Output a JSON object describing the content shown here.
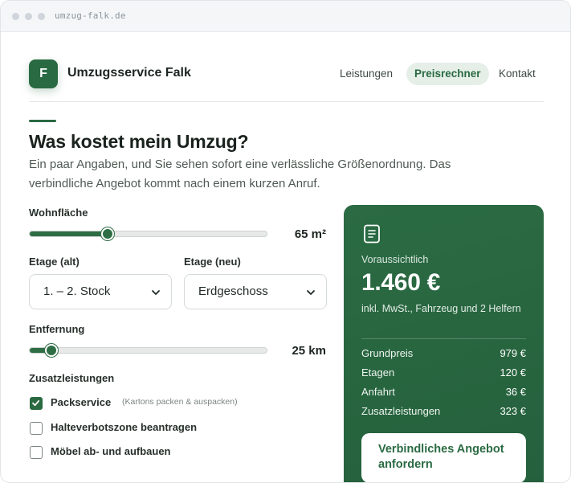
{
  "browser": {
    "url": "umzug-falk.de"
  },
  "header": {
    "logo_letter": "F",
    "brand": "Umzugsservice Falk",
    "nav": [
      {
        "label": "Leistungen",
        "active": false
      },
      {
        "label": "Preisrechner",
        "active": true
      },
      {
        "label": "Kontakt",
        "active": false
      }
    ]
  },
  "main": {
    "title": "Was kostet mein Umzug?",
    "intro": "Ein paar Angaben, und Sie sehen sofort eine verlässliche Größenordnung. Das verbindliche Angebot kommt nach einem kurzen Anruf.",
    "area": {
      "label": "Wohnfläche",
      "value_text": "65 m²",
      "fraction": 0.33
    },
    "floor_old": {
      "label": "Etage (alt)",
      "selected": "1. – 2. Stock"
    },
    "floor_new": {
      "label": "Etage (neu)",
      "selected": "Erdgeschoss"
    },
    "distance": {
      "label": "Entfernung",
      "value_text": "25 km",
      "fraction": 0.09
    },
    "extras": {
      "label": "Zusatzleistungen",
      "items": [
        {
          "label": "Packservice",
          "hint": "(Kartons packen & auspacken)",
          "checked": true
        },
        {
          "label": "Halteverbotszone beantragen",
          "hint": "",
          "checked": false
        },
        {
          "label": "Möbel ab- und aufbauen",
          "hint": "",
          "checked": false
        }
      ]
    }
  },
  "summary": {
    "icon": "document-icon",
    "caption": "Voraussichtlich",
    "price": "1.460 €",
    "note": "inkl. MwSt., Fahrzeug und 2 Helfern",
    "rows": [
      {
        "label": "Grundpreis",
        "value": "979 €"
      },
      {
        "label": "Etagen",
        "value": "120 €"
      },
      {
        "label": "Anfahrt",
        "value": "36 €"
      },
      {
        "label": "Zusatzleistungen",
        "value": "323 €"
      }
    ],
    "cta": "Verbindliches Angebot anfordern"
  },
  "colors": {
    "accent": "#2a6a42",
    "card": "#2b6b43",
    "nav_active_bg": "#e5efe8"
  }
}
